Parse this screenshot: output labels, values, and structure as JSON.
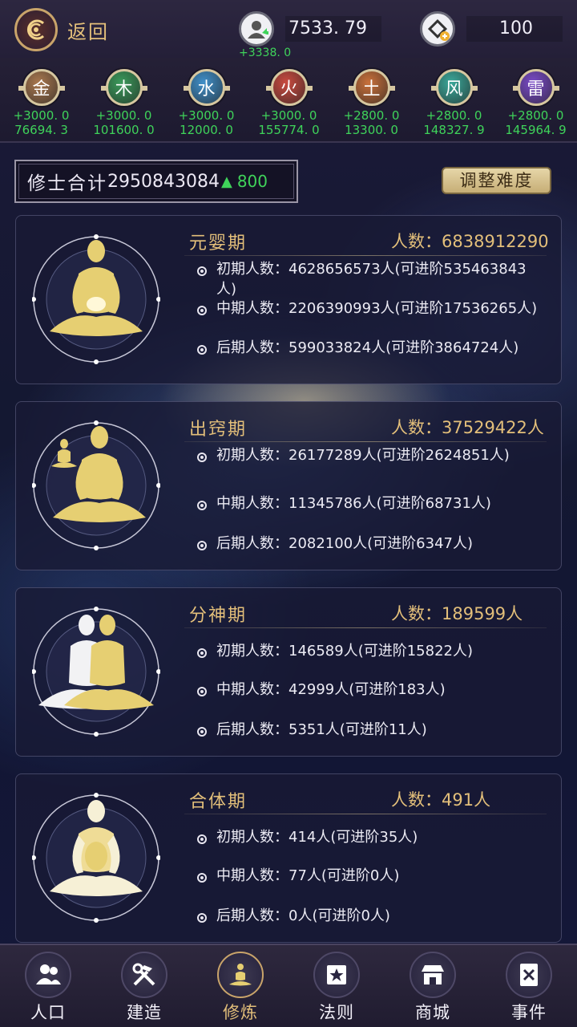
{
  "topbar": {
    "back_label": "返回",
    "silver": {
      "value": "7533. 79",
      "delta": "+3338. 0"
    },
    "gold": {
      "value": "100"
    }
  },
  "elements": [
    {
      "name": "金",
      "rate": "+3000. 0",
      "total": "76694. 3",
      "color": "#a9784f"
    },
    {
      "name": "木",
      "rate": "+3000. 0",
      "total": "101600. 0",
      "color": "#3a9a5a"
    },
    {
      "name": "水",
      "rate": "+3000. 0",
      "total": "12000. 0",
      "color": "#3f8fc9"
    },
    {
      "name": "火",
      "rate": "+3000. 0",
      "total": "155774. 0",
      "color": "#c94a3f"
    },
    {
      "name": "土",
      "rate": "+2800. 0",
      "total": "13300. 0",
      "color": "#c9703a"
    },
    {
      "name": "风",
      "rate": "+2800. 0",
      "total": "148327. 9",
      "color": "#3aa89a"
    },
    {
      "name": "雷",
      "rate": "+2800. 0",
      "total": "145964. 9",
      "color": "#7a4ac9"
    }
  ],
  "summary": {
    "label": "修士合计",
    "value": "2950843084",
    "delta": "800"
  },
  "difficulty_button": "调整难度",
  "realms": [
    {
      "title": "元婴期",
      "count": "人数：6838912290",
      "stages": [
        "初期人数：4628656573人(可进阶535463843人)",
        "中期人数：2206390993人(可进阶17536265人)",
        "后期人数：599033824人(可进阶3864724人)"
      ]
    },
    {
      "title": "出窍期",
      "count": "人数：37529422人",
      "stages": [
        "初期人数：26177289人(可进阶2624851人)",
        "中期人数：11345786人(可进阶68731人)",
        "后期人数：2082100人(可进阶6347人)"
      ]
    },
    {
      "title": "分神期",
      "count": "人数：189599人",
      "stages": [
        "初期人数：146589人(可进阶15822人)",
        "中期人数：42999人(可进阶183人)",
        "后期人数：5351人(可进阶11人)"
      ]
    },
    {
      "title": "合体期",
      "count": "人数：491人",
      "stages": [
        "初期人数：414人(可进阶35人)",
        "中期人数：77人(可进阶0人)",
        "后期人数：0人(可进阶0人)"
      ]
    }
  ],
  "nav": [
    {
      "label": "人口",
      "icon": "people-icon"
    },
    {
      "label": "建造",
      "icon": "tools-icon"
    },
    {
      "label": "修炼",
      "icon": "meditate-icon"
    },
    {
      "label": "法则",
      "icon": "law-icon"
    },
    {
      "label": "商城",
      "icon": "shop-icon"
    },
    {
      "label": "事件",
      "icon": "event-book-icon"
    }
  ],
  "nav_active": "修炼",
  "colors": {
    "gold_text": "#e3bf7a",
    "green_delta": "#3fd35a",
    "figure_gold": "#e6cf72"
  }
}
